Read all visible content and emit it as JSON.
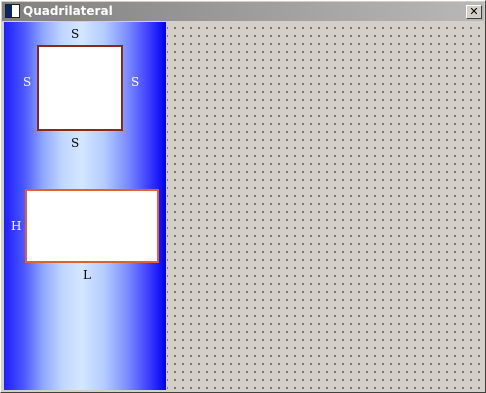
{
  "window": {
    "title": "Quadrilateral",
    "close_label": "✕"
  },
  "sidebar": {
    "square": {
      "top_label": "S",
      "left_label": "S",
      "right_label": "S",
      "bottom_label": "S",
      "border_color": "#8b2a12"
    },
    "rectangle": {
      "height_label": "H",
      "length_label": "L",
      "border_color": "#e06030"
    },
    "colors": {
      "gradient_edge": "#1e1eff",
      "gradient_center": "#d4e6ff"
    }
  },
  "canvas": {
    "background": "#d4d0c8",
    "dot_color": "#000000"
  }
}
